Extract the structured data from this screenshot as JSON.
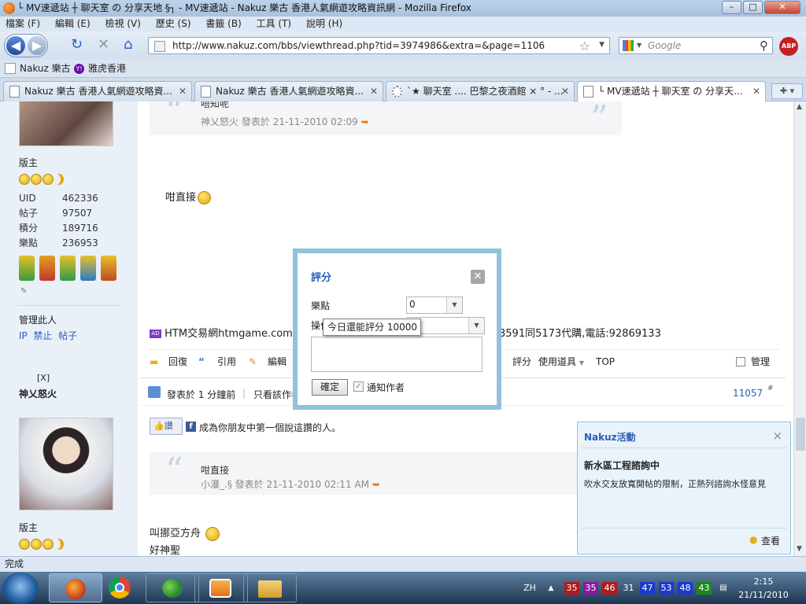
{
  "window": {
    "title": "└ MV速遞站 ┼ 聊天室 の 分享天地 §┐ - MV速遞站 - Nakuz 樂古 香港人氣網遊攻略資訊網 - Mozilla Firefox",
    "min": "–",
    "max": "□",
    "close": "✕"
  },
  "menu": [
    "檔案 (F)",
    "編輯 (E)",
    "檢視 (V)",
    "歷史 (S)",
    "書籤 (B)",
    "工具 (T)",
    "說明 (H)"
  ],
  "nav": {
    "url": "http://www.nakuz.com/bbs/viewthread.php?tid=3974986&extra=&page=1106",
    "search_placeholder": "Google",
    "abp": "ABP"
  },
  "bookmarks": [
    "Nakuz 樂古",
    "雅虎香港"
  ],
  "tabs": [
    {
      "label": "Nakuz 樂古 香港人氣網遊攻略資..."
    },
    {
      "label": "Nakuz 樂古 香港人氣網遊攻略資..."
    },
    {
      "label": "`★ 聊天室 .... 巴黎之夜酒館 × ° - ..."
    },
    {
      "label": "└ MV速遞站 ┼ 聊天室 の 分享天..."
    }
  ],
  "post1": {
    "role": "版主",
    "stats": [
      {
        "k": "UID",
        "v": "462336"
      },
      {
        "k": "帖子",
        "v": "97507"
      },
      {
        "k": "積分",
        "v": "189716"
      },
      {
        "k": "樂點",
        "v": "236953"
      }
    ],
    "manage_label": "管理此人",
    "manage_links": [
      "IP",
      "禁止",
      "帖子"
    ],
    "quote_text": "唔知呢",
    "quote_meta": "神乂怒火 發表於 21-11-2010 02:09",
    "body": "咁直接",
    "ad_text": "HTM交易網htmgame.com 放",
    "ad_text_right": "3591同5173代購,電話:92869133",
    "actions": [
      "回復",
      "引用",
      "編輯"
    ],
    "actions_right": [
      "評分",
      "使用道具",
      "TOP"
    ],
    "manage_check": "管理"
  },
  "post2": {
    "close_x": "[X]",
    "username": "神乂怒火",
    "posted": "發表於 1 分鐘前",
    "only_author": "只看該作者",
    "post_num": "11057",
    "post_num_suffix": "#",
    "like": "讚",
    "fb_text": "成為你朋友中第一個說這讚的人。",
    "quote_text": "咁直接",
    "quote_meta": "小瀑_.§ 發表於 21-11-2010 02:11 AM",
    "body_line1": "叫挪亞方舟",
    "body_line2": "好神聖",
    "role": "版主"
  },
  "modal": {
    "title": "評分",
    "close": "✕",
    "field1_label": "樂點",
    "field1_value": "0",
    "field2_label": "操作說明",
    "tooltip": "今日還能評分 10000",
    "submit": "確定",
    "notify": "通知作者"
  },
  "activity": {
    "title": "Nakuz活動",
    "close": "×",
    "headline": "新水區工程諮詢中",
    "text": "吹水交友放寬開帖的限制，正熱列諮詢水怪意見",
    "view": "查看"
  },
  "status": {
    "text": "完成"
  },
  "taskbar": {
    "lang": "ZH",
    "tray_numbers": [
      {
        "v": "35",
        "c": "#b01a1a"
      },
      {
        "v": "35",
        "c": "#8a1aa0"
      },
      {
        "v": "46",
        "c": "#b01a1a"
      },
      {
        "v": "31",
        "c": "transparent"
      },
      {
        "v": "47",
        "c": "#1a3bd0"
      },
      {
        "v": "53",
        "c": "#1a3bd0"
      },
      {
        "v": "48",
        "c": "#1a3bd0"
      },
      {
        "v": "43",
        "c": "#1a8a1a"
      }
    ],
    "time": "2:15",
    "date": "21/11/2010"
  }
}
